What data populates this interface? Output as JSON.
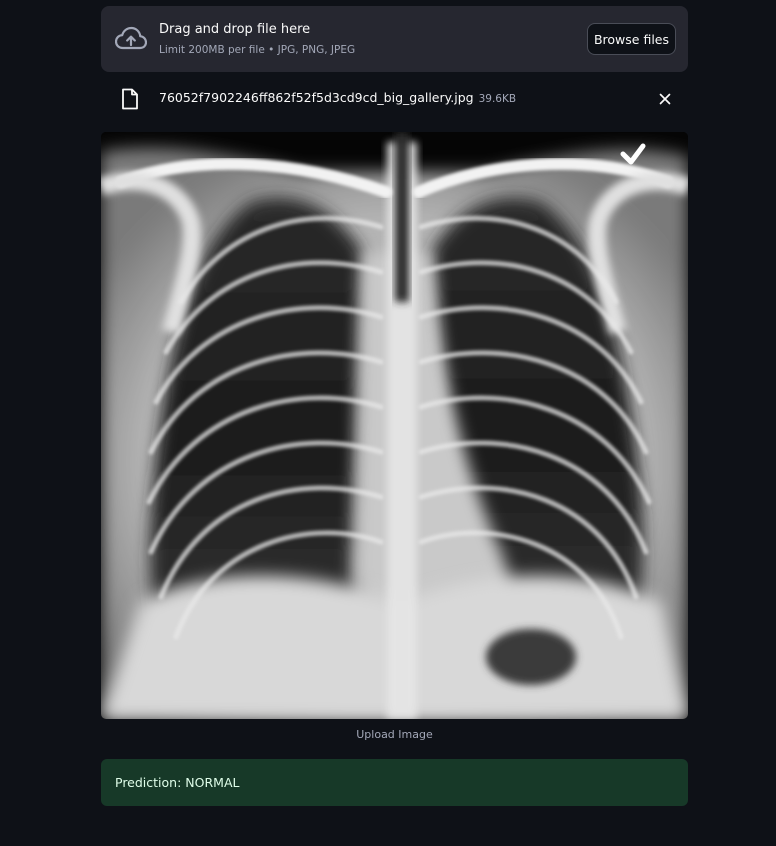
{
  "uploader": {
    "title": "Drag and drop file here",
    "subtitle": "Limit 200MB per file • JPG, PNG, JPEG",
    "browse_label": "Browse files",
    "icon": "cloud-upload-icon"
  },
  "file": {
    "name": "76052f7902246ff862f52f5d3cd9cd_big_gallery.jpg",
    "size": "39.6KB",
    "icon": "file-icon",
    "remove_icon": "close-icon"
  },
  "image": {
    "caption": "Upload Image"
  },
  "prediction": {
    "text": "Prediction: NORMAL"
  },
  "colors": {
    "background": "#0e1117",
    "panel": "#262730",
    "success_bg": "#173928",
    "success_text": "#dffde9"
  }
}
